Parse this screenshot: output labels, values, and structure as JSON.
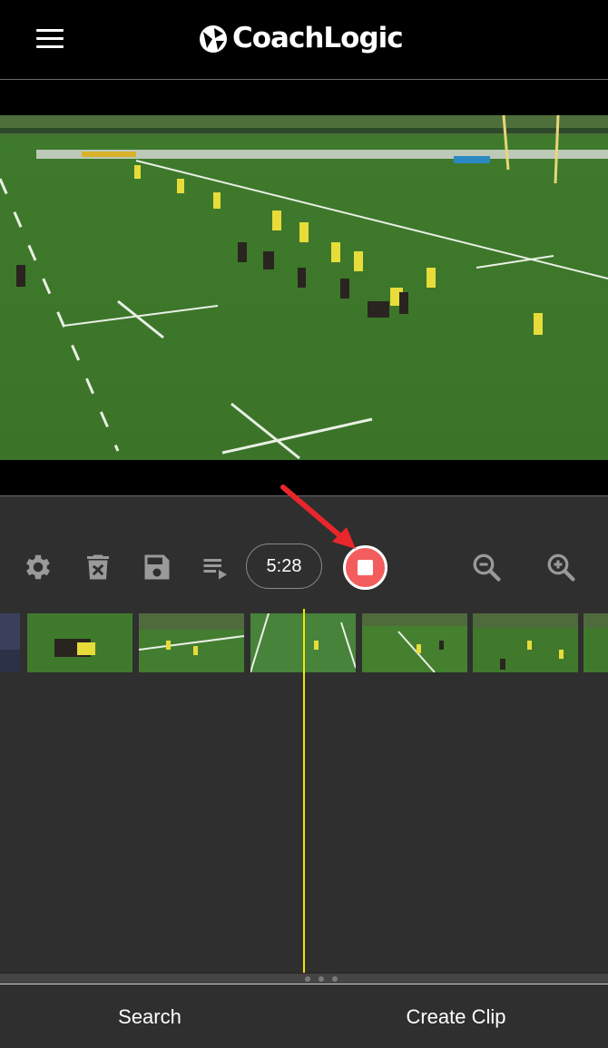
{
  "header": {
    "menu_icon": "hamburger-menu-icon",
    "logo_text": "CoachLogic",
    "logo_icon": "coachlogic-logo-icon"
  },
  "video": {
    "description_icon": "video-player"
  },
  "toolbar": {
    "settings_icon": "gear-icon",
    "delete_icon": "delete-clip-icon",
    "save_icon": "save-icon",
    "playlist_icon": "playlist-play-icon",
    "time": "5:28",
    "record_icon": "stop-icon",
    "zoom_out_icon": "zoom-out-icon",
    "zoom_in_icon": "zoom-in-icon"
  },
  "timeline": {
    "thumbnail_count_visible": 6,
    "playhead_color": "#f2e600"
  },
  "bottom_nav": {
    "search_label": "Search",
    "create_clip_label": "Create Clip"
  },
  "colors": {
    "record": "#f45d5d",
    "panel": "#2f2f2f",
    "annotation_arrow": "#e8262c"
  }
}
